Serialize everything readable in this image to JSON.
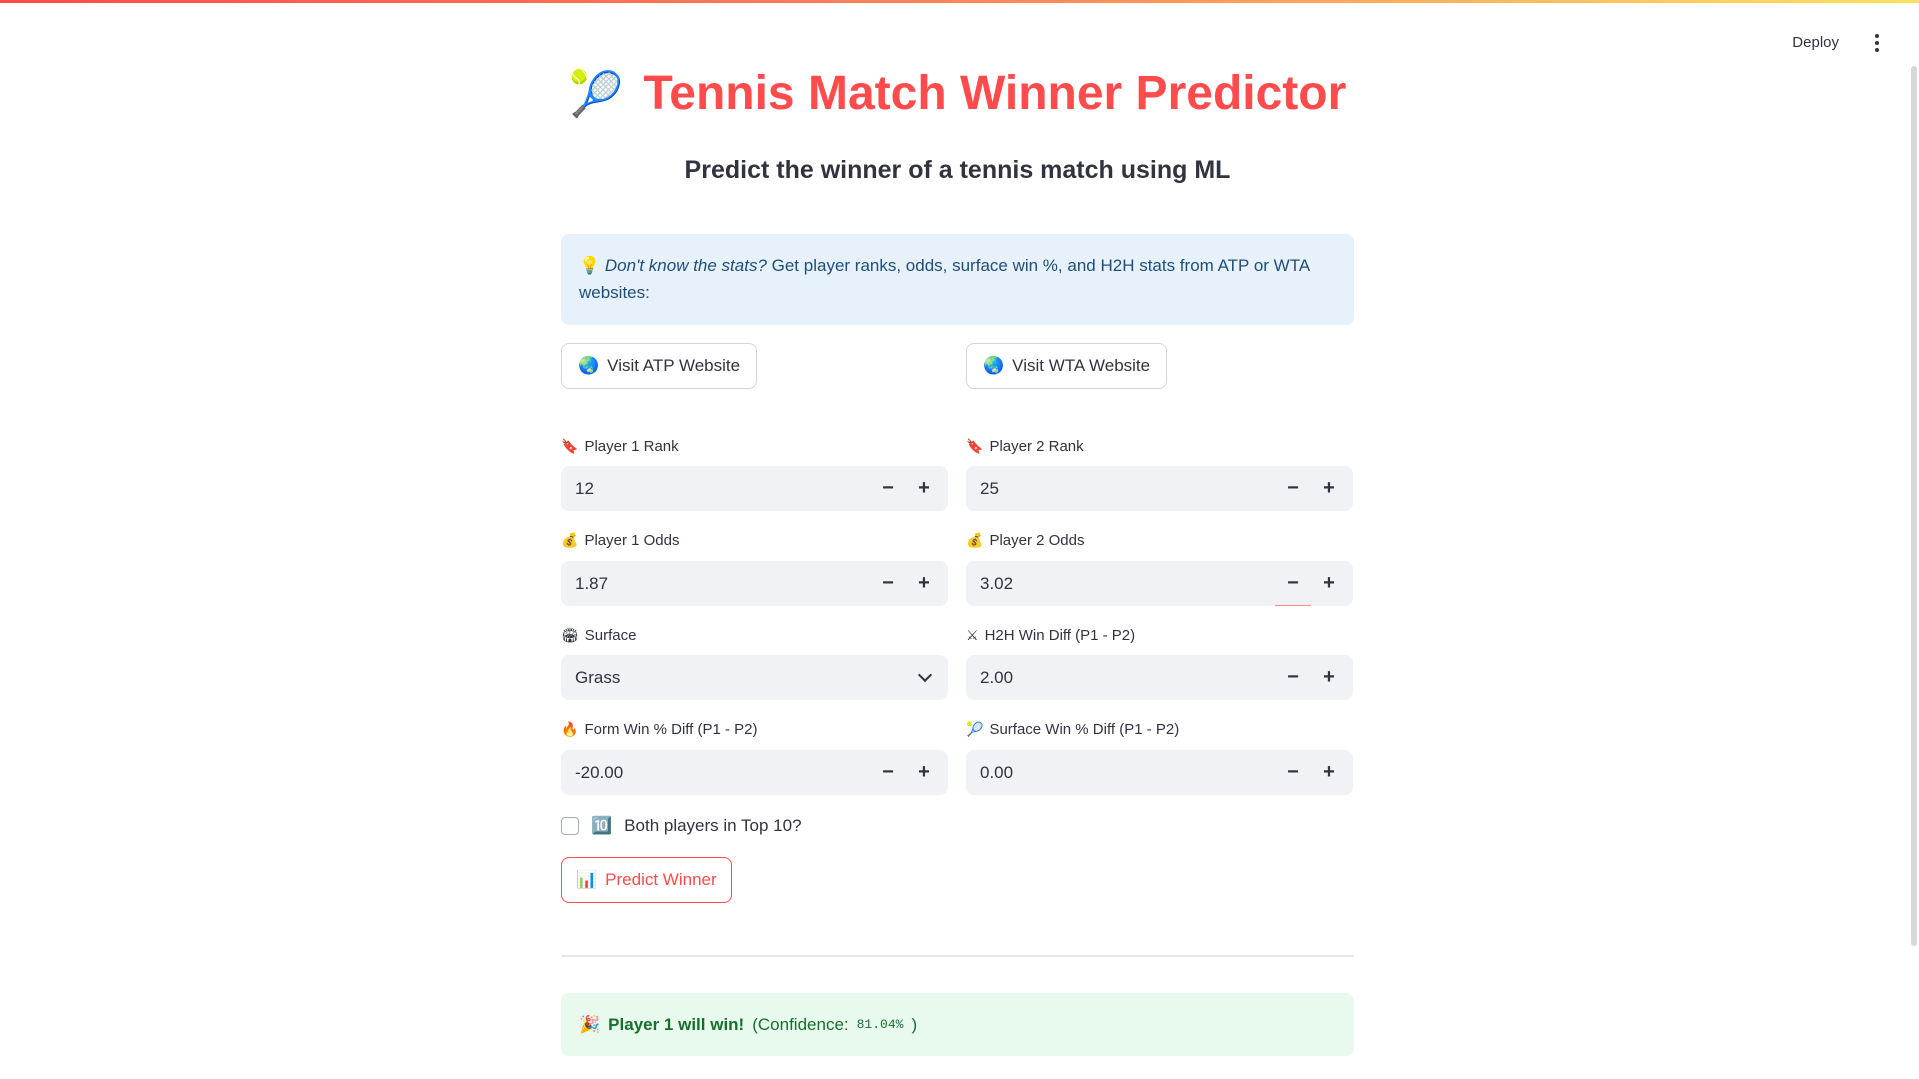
{
  "header": {
    "deploy_label": "Deploy",
    "menu_icon": "kebab-menu-icon"
  },
  "page": {
    "title_icon": "🎾",
    "title": "Tennis Match Winner Predictor",
    "subtitle": "Predict the winner of a tennis match using ML"
  },
  "info": {
    "icon": "💡",
    "emphasis": "Don't know the stats?",
    "text": " Get player ranks, odds, surface win %, and H2H stats from ATP or WTA websites:"
  },
  "links": {
    "atp": {
      "icon": "🌏",
      "label": "Visit ATP Website"
    },
    "wta": {
      "icon": "🌏",
      "label": "Visit WTA Website"
    }
  },
  "fields": {
    "p1_rank": {
      "icon": "🔖",
      "label": "Player 1 Rank",
      "value": "12"
    },
    "p2_rank": {
      "icon": "🔖",
      "label": "Player 2 Rank",
      "value": "25"
    },
    "p1_odds": {
      "icon": "💰",
      "label": "Player 1 Odds",
      "value": "1.87"
    },
    "p2_odds": {
      "icon": "💰",
      "label": "Player 2 Odds",
      "value": "3.02"
    },
    "surface": {
      "icon": "🏟",
      "label": "Surface",
      "value": "Grass"
    },
    "h2h": {
      "icon": "⚔",
      "label": "H2H Win Diff (P1 - P2)",
      "value": "2.00"
    },
    "form": {
      "icon": "🔥",
      "label": "Form Win % Diff (P1 - P2)",
      "value": "-20.00"
    },
    "surface_win": {
      "icon": "🎾",
      "label": "Surface Win % Diff (P1 - P2)",
      "value": "0.00"
    }
  },
  "stepper": {
    "minus": "−",
    "plus": "+"
  },
  "top10": {
    "icon": "🔟",
    "label": "Both players in Top 10?",
    "checked": false
  },
  "predict": {
    "icon": "📊",
    "label": "Predict Winner"
  },
  "result": {
    "icon": "🎉",
    "headline": "Player 1 will win!",
    "prefix": " (Confidence: ",
    "confidence": "81.04%",
    "suffix": ")"
  }
}
